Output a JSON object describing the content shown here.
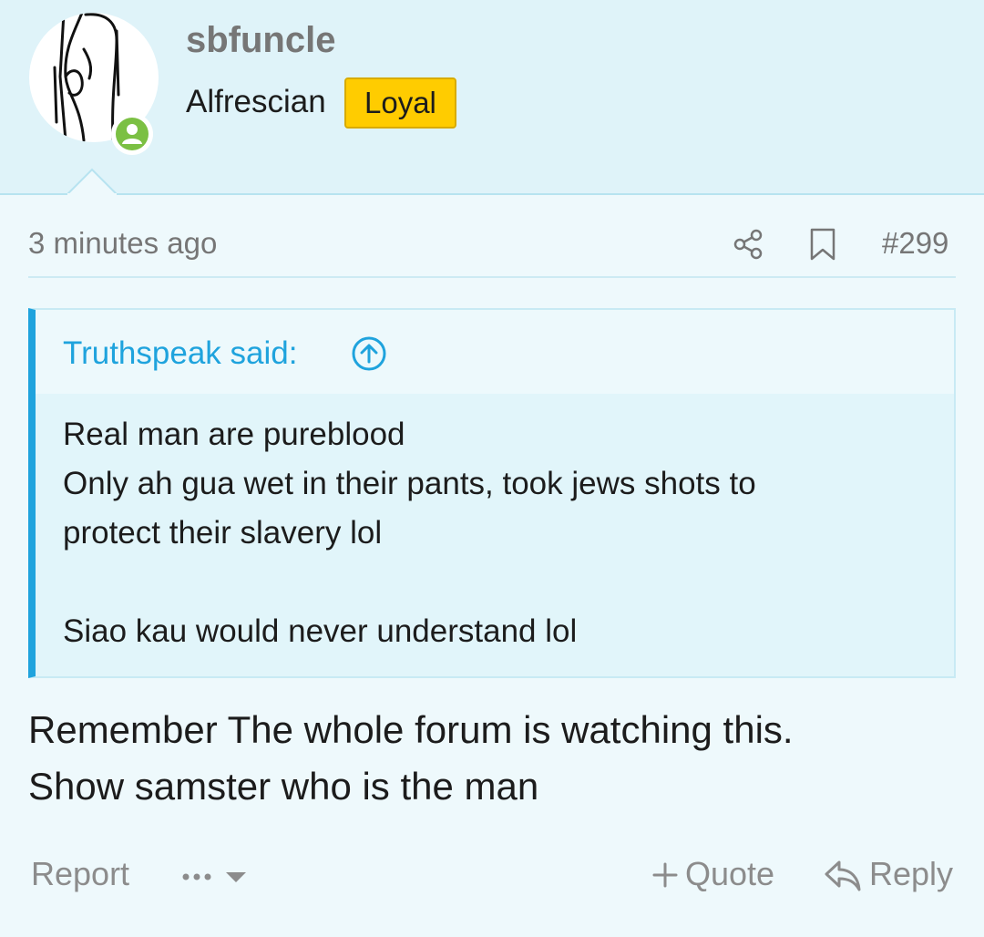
{
  "user": {
    "username": "sbfuncle",
    "title": "Alfrescian",
    "badge": "Loyal"
  },
  "meta": {
    "time": "3 minutes ago",
    "post_number": "#299"
  },
  "quote": {
    "title": "Truthspeak said:",
    "lines": [
      "Real man are pureblood",
      "Only ah gua wet in their pants, took jews shots to",
      "protect their slavery lol",
      "",
      "Siao kau would never understand lol"
    ]
  },
  "message": {
    "lines": [
      "Remember The whole forum is watching this.",
      "Show samster who is the man"
    ]
  },
  "actions": {
    "report": "Report",
    "quote": "Quote",
    "reply": "Reply"
  },
  "colors": {
    "accent": "#1fa3dd",
    "badge": "#ffcc00",
    "online": "#7bc043"
  }
}
